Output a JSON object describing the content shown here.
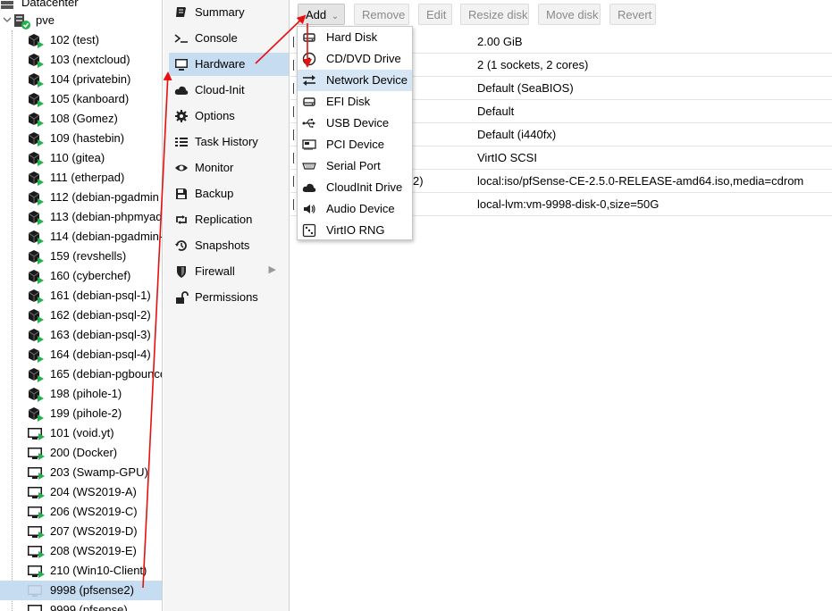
{
  "tree": {
    "datacenter_label": "Datacenter",
    "node_label": "pve",
    "guests": [
      {
        "label": "102 (test)",
        "kind": "ct"
      },
      {
        "label": "103 (nextcloud)",
        "kind": "ct"
      },
      {
        "label": "104 (privatebin)",
        "kind": "ct"
      },
      {
        "label": "105 (kanboard)",
        "kind": "ct"
      },
      {
        "label": "108 (Gomez)",
        "kind": "ct"
      },
      {
        "label": "109 (hastebin)",
        "kind": "ct"
      },
      {
        "label": "110 (gitea)",
        "kind": "ct"
      },
      {
        "label": "111 (etherpad)",
        "kind": "ct"
      },
      {
        "label": "112 (debian-pgadmin",
        "kind": "ct"
      },
      {
        "label": "113 (debian-phpmyad",
        "kind": "ct"
      },
      {
        "label": "114 (debian-pgadmin-",
        "kind": "ct"
      },
      {
        "label": "159 (revshells)",
        "kind": "ct"
      },
      {
        "label": "160 (cyberchef)",
        "kind": "ct"
      },
      {
        "label": "161 (debian-psql-1)",
        "kind": "ct"
      },
      {
        "label": "162 (debian-psql-2)",
        "kind": "ct"
      },
      {
        "label": "163 (debian-psql-3)",
        "kind": "ct"
      },
      {
        "label": "164 (debian-psql-4)",
        "kind": "ct"
      },
      {
        "label": "165 (debian-pgbounce",
        "kind": "ct"
      },
      {
        "label": "198 (pihole-1)",
        "kind": "ct"
      },
      {
        "label": "199 (pihole-2)",
        "kind": "ct"
      },
      {
        "label": "101 (void.yt)",
        "kind": "vm"
      },
      {
        "label": "200 (Docker)",
        "kind": "vm"
      },
      {
        "label": "203 (Swamp-GPU)",
        "kind": "vm"
      },
      {
        "label": "204 (WS2019-A)",
        "kind": "vm"
      },
      {
        "label": "206 (WS2019-C)",
        "kind": "vm"
      },
      {
        "label": "207 (WS2019-D)",
        "kind": "vm"
      },
      {
        "label": "208 (WS2019-E)",
        "kind": "vm"
      },
      {
        "label": "210 (Win10-Client)",
        "kind": "vm"
      },
      {
        "label": "9998 (pfsense2)",
        "kind": "vm-stopped",
        "selected": true
      },
      {
        "label": "9999 (pfsense)",
        "kind": "vm-stopped"
      }
    ]
  },
  "nav": {
    "items": [
      {
        "label": "Summary",
        "icon": "book-icon"
      },
      {
        "label": "Console",
        "icon": "terminal-icon"
      },
      {
        "label": "Hardware",
        "icon": "monitor-icon",
        "active": true
      },
      {
        "label": "Cloud-Init",
        "icon": "cloud-icon"
      },
      {
        "label": "Options",
        "icon": "gear-icon"
      },
      {
        "label": "Task History",
        "icon": "list-icon"
      },
      {
        "label": "Monitor",
        "icon": "eye-icon"
      },
      {
        "label": "Backup",
        "icon": "floppy-icon"
      },
      {
        "label": "Replication",
        "icon": "retweet-icon"
      },
      {
        "label": "Snapshots",
        "icon": "history-icon"
      },
      {
        "label": "Firewall",
        "icon": "shield-icon",
        "has_submenu": true
      },
      {
        "label": "Permissions",
        "icon": "unlock-icon"
      }
    ]
  },
  "toolbar": {
    "add_label": "Add",
    "remove_label": "Remove",
    "edit_label": "Edit",
    "resize_label": "Resize disk",
    "move_label": "Move disk",
    "revert_label": "Revert"
  },
  "hardware_rows": [
    {
      "value": "2.00 GiB"
    },
    {
      "value": "2 (1 sockets, 2 cores)"
    },
    {
      "value": "Default (SeaBIOS)"
    },
    {
      "value": "Default"
    },
    {
      "value": "Default (i440fx)"
    },
    {
      "value": "VirtIO SCSI"
    },
    {
      "partial_label": "2)",
      "value": "local:iso/pfSense-CE-2.5.0-RELEASE-amd64.iso,media=cdrom"
    },
    {
      "value": "local-lvm:vm-9998-disk-0,size=50G"
    }
  ],
  "add_menu": {
    "items": [
      {
        "label": "Hard Disk",
        "icon": "hdd-icon"
      },
      {
        "label": "CD/DVD Drive",
        "icon": "disc-icon"
      },
      {
        "label": "Network Device",
        "icon": "exchange-icon",
        "highlighted": true
      },
      {
        "label": "EFI Disk",
        "icon": "hdd-icon"
      },
      {
        "label": "USB Device",
        "icon": "usb-icon"
      },
      {
        "label": "PCI Device",
        "icon": "pci-card-icon"
      },
      {
        "label": "Serial Port",
        "icon": "serial-port-icon"
      },
      {
        "label": "CloudInit Drive",
        "icon": "cloud-icon"
      },
      {
        "label": "Audio Device",
        "icon": "speaker-icon"
      },
      {
        "label": "VirtIO RNG",
        "icon": "dice-icon"
      }
    ]
  },
  "colors": {
    "selection": "#c6dcf0",
    "menu_highlight": "#d6e6f5",
    "annotation_arrow": "#e8100f",
    "running_badge": "#21b24b"
  }
}
